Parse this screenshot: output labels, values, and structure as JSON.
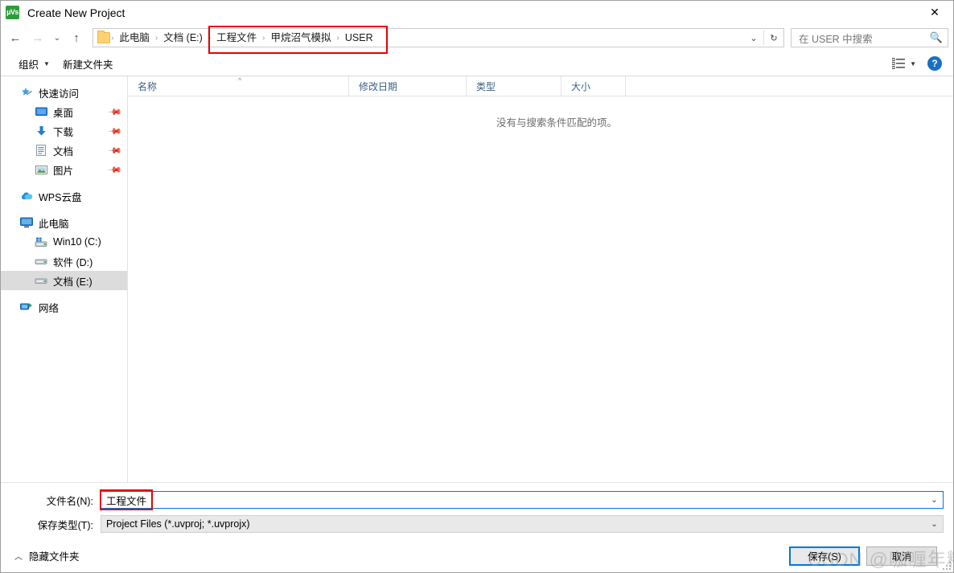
{
  "window": {
    "title": "Create New Project",
    "app_icon": "keil-uvision-icon",
    "close_label": "✕"
  },
  "nav": {
    "back": "←",
    "forward": "→",
    "recent": "⌄",
    "up": "↑",
    "refresh": "↻",
    "dropdown": "⌄"
  },
  "address": {
    "folder_icon": "folder-icon",
    "separator": "›",
    "crumbs": [
      {
        "label": "此电脑",
        "highlighted": false
      },
      {
        "label": "文档 (E:)",
        "highlighted": false
      },
      {
        "label": "工程文件",
        "highlighted": true
      },
      {
        "label": "甲烷沼气模拟",
        "highlighted": true
      },
      {
        "label": "USER",
        "highlighted": true
      }
    ]
  },
  "search": {
    "placeholder": "在 USER 中搜索",
    "icon": "search-icon"
  },
  "toolbar": {
    "organize_label": "组织",
    "organize_caret": "▼",
    "new_folder_label": "新建文件夹",
    "view_icon": "view-options-icon",
    "view_caret": "▼",
    "help_label": "?"
  },
  "sidebar": {
    "groups": [
      {
        "header": {
          "label": "快速访问",
          "icon": "star-pin-icon"
        },
        "items": [
          {
            "label": "桌面",
            "icon": "desktop-icon",
            "pinned": true,
            "selected": false
          },
          {
            "label": "下载",
            "icon": "download-icon",
            "pinned": true,
            "selected": false
          },
          {
            "label": "文档",
            "icon": "documents-icon",
            "pinned": true,
            "selected": false
          },
          {
            "label": "图片",
            "icon": "pictures-icon",
            "pinned": true,
            "selected": false
          }
        ]
      },
      {
        "header": {
          "label": "WPS云盘",
          "icon": "cloud-icon"
        },
        "items": []
      },
      {
        "header": {
          "label": "此电脑",
          "icon": "this-pc-icon"
        },
        "items": [
          {
            "label": "Win10 (C:)",
            "icon": "system-drive-icon",
            "pinned": false,
            "selected": false
          },
          {
            "label": "软件 (D:)",
            "icon": "drive-icon",
            "pinned": false,
            "selected": false
          },
          {
            "label": "文档 (E:)",
            "icon": "drive-icon",
            "pinned": false,
            "selected": true
          }
        ]
      },
      {
        "header": {
          "label": "网络",
          "icon": "network-icon"
        },
        "items": []
      }
    ]
  },
  "filelist": {
    "columns": [
      {
        "label": "名称",
        "sorted": "asc"
      },
      {
        "label": "修改日期",
        "sorted": ""
      },
      {
        "label": "类型",
        "sorted": ""
      },
      {
        "label": "大小",
        "sorted": ""
      }
    ],
    "sort_caret": "^",
    "empty_message": "没有与搜索条件匹配的项。",
    "rows": []
  },
  "form": {
    "filename_label": "文件名(N):",
    "filename_value": "工程文件",
    "filetype_label": "保存类型(T):",
    "filetype_value": "Project Files (*.uvproj; *.uvprojx)",
    "chevron": "⌄"
  },
  "footer": {
    "hide_folders_label": "隐藏文件夹",
    "hide_folders_chevron": "︿",
    "save_label": "保存(S)",
    "cancel_label": "取消"
  },
  "watermark": {
    "text": "CSDN @咖喱年糕"
  },
  "colors": {
    "accent": "#0078d7",
    "highlight_box": "#e60000",
    "selected_row": "#dcdcdc",
    "column_header_text": "#3d6185",
    "app_icon": "#2e9b3c"
  }
}
